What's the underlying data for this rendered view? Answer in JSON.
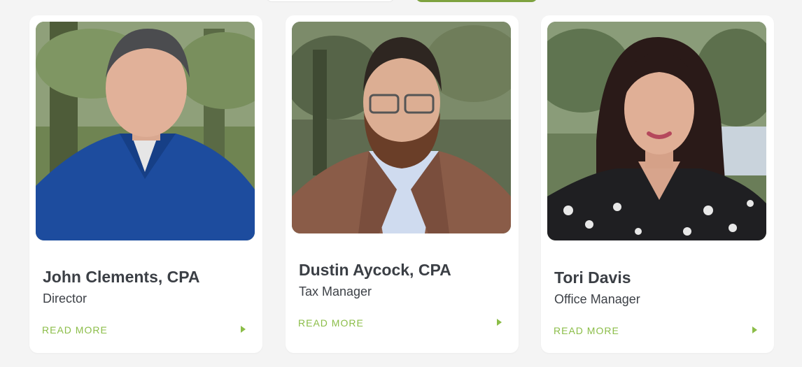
{
  "team": [
    {
      "name": "John Clements, CPA",
      "role": "Director",
      "cta": "READ MORE",
      "photo": "portrait-photo"
    },
    {
      "name": "Dustin Aycock, CPA",
      "role": "Tax Manager",
      "cta": "READ MORE",
      "photo": "portrait-photo"
    },
    {
      "name": "Tori Davis",
      "role": "Office Manager",
      "cta": "READ MORE",
      "photo": "portrait-photo"
    }
  ],
  "colors": {
    "accent": "#8bbd48",
    "button_green": "#7ea23f",
    "text_dark": "#3b3f45",
    "page_bg": "#f4f4f4"
  }
}
